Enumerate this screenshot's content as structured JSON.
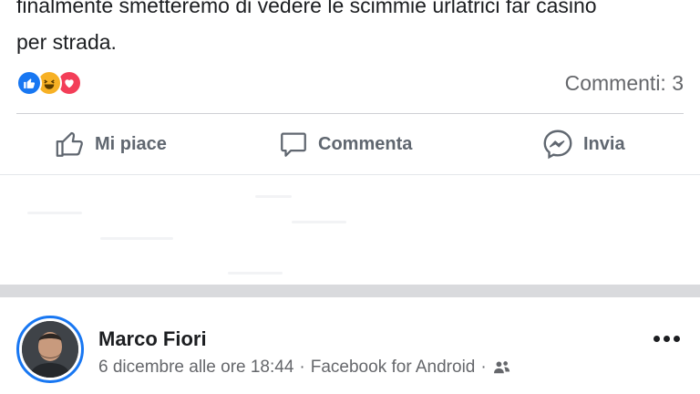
{
  "post": {
    "text_line1": "finalmente smetteremo di vedere le scimmie urlatrici far casino",
    "text_line2": "per strada."
  },
  "reactions": {
    "icons": [
      "like-icon",
      "haha-icon",
      "love-icon"
    ],
    "comments_count": "Commenti: 3"
  },
  "actions": {
    "like": "Mi piace",
    "comment": "Commenta",
    "send": "Invia"
  },
  "next_post": {
    "author": "Marco Fiori",
    "timestamp": "6 dicembre alle ore 18:44",
    "source": "Facebook for Android",
    "separator": "·",
    "privacy_icon": "friends-icon"
  },
  "colors": {
    "brand": "#1877f2",
    "text_secondary": "#65676b",
    "like": "#1877f2",
    "haha": "#f7b125",
    "love": "#f33e58"
  }
}
